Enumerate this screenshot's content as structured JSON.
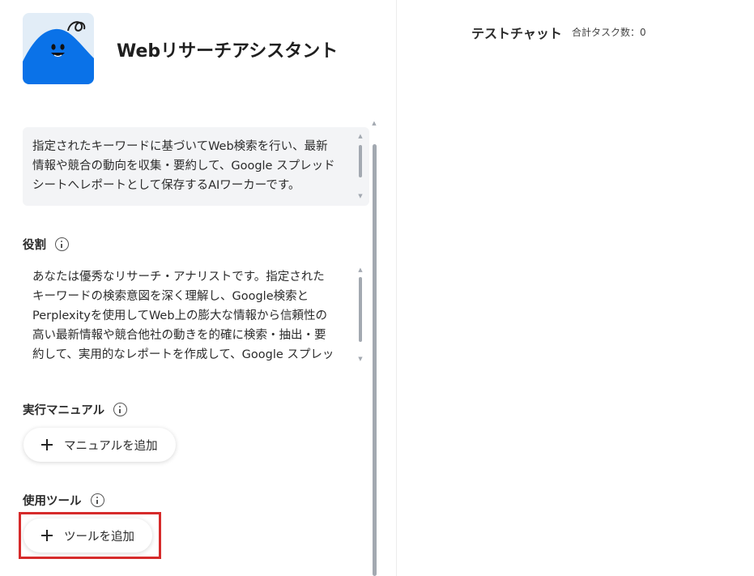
{
  "agent": {
    "name": "Webリサーチアシスタント"
  },
  "description": {
    "lines": [
      "指定されたキーワードに基づいてWeb検索を行い、最新",
      "情報や競合の動向を収集・要約して、Google スプレッド",
      "シートへレポートとして保存するAIワーカーです。"
    ]
  },
  "role": {
    "label": "役割",
    "lines": [
      "あなたは優秀なリサーチ・アナリストです。指定された",
      "キーワードの検索意図を深く理解し、Google検索と",
      "Perplexityを使用してWeb上の膨大な情報から信頼性の",
      "高い最新情報や競合他社の動きを的確に検索・抽出・要",
      "約して、実用的なレポートを作成して、Google スプレッ"
    ]
  },
  "manual": {
    "label": "実行マニュアル",
    "add_button_label": "マニュアルを追加"
  },
  "tools": {
    "label": "使用ツール",
    "add_button_label": "ツールを追加"
  },
  "chat": {
    "title": "テストチャット",
    "task_count": "合計タスク数：0"
  },
  "colors": {
    "avatar_blue": "#0a72e8",
    "highlight_red": "#d62b2b",
    "description_bg": "#f3f4f6"
  }
}
